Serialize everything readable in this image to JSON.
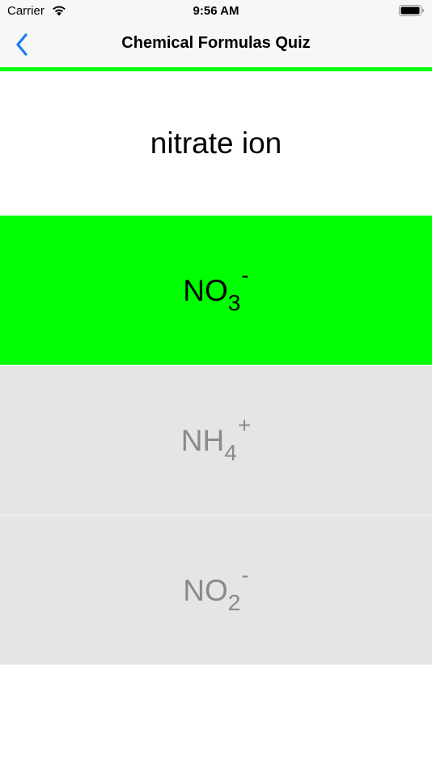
{
  "status_bar": {
    "carrier": "Carrier",
    "time": "9:56 AM"
  },
  "nav": {
    "title": "Chemical Formulas Quiz",
    "accent_color": "#1a7cf4"
  },
  "progress": {
    "color": "#00ff00",
    "fraction": 1.0
  },
  "question": {
    "text": "nitrate ion"
  },
  "answers": [
    {
      "base": "NO",
      "subscript": "3",
      "superscript": "-",
      "state": "correct",
      "background": "#00ff00"
    },
    {
      "base": "NH",
      "subscript": "4",
      "superscript": "+",
      "state": "dimmed",
      "background": "#e5e5e5"
    },
    {
      "base": "NO",
      "subscript": "2",
      "superscript": "-",
      "state": "dimmed",
      "background": "#e5e5e5"
    }
  ]
}
